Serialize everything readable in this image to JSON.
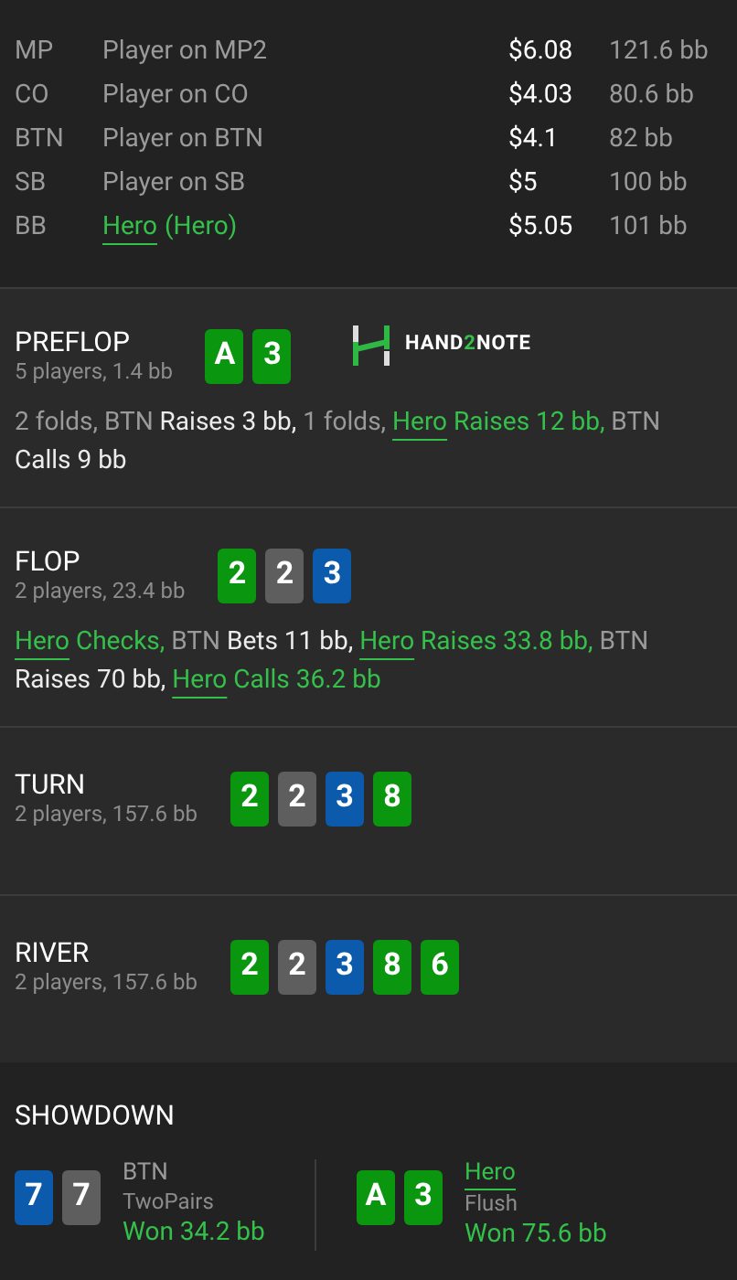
{
  "players": [
    {
      "position": "MP",
      "name": "Player on MP2",
      "is_hero": false,
      "stack": "$6.08",
      "stack_bb": "121.6 bb"
    },
    {
      "position": "CO",
      "name": "Player on CO",
      "is_hero": false,
      "stack": "$4.03",
      "stack_bb": "80.6 bb"
    },
    {
      "position": "BTN",
      "name": "Player on BTN",
      "is_hero": false,
      "stack": "$4.1",
      "stack_bb": "82 bb"
    },
    {
      "position": "SB",
      "name": "Player on SB",
      "is_hero": false,
      "stack": "$5",
      "stack_bb": "100 bb"
    },
    {
      "position": "BB",
      "name": "Hero",
      "is_hero": true,
      "suffix": "(Hero)",
      "stack": "$5.05",
      "stack_bb": "101 bb"
    }
  ],
  "streets": [
    {
      "title": "PREFLOP",
      "info": "5 players, 1.4 bb",
      "cards": [
        {
          "rank": "A",
          "color": "#0a960f"
        },
        {
          "rank": "3",
          "color": "#0a960f"
        }
      ],
      "logo": [
        {
          "text": "HAND",
          "accent": false
        },
        {
          "text": "2",
          "accent": true
        },
        {
          "text": "NOTE",
          "accent": false
        }
      ],
      "actions": [
        {
          "text": "2 folds, BTN ",
          "kind": "plain"
        },
        {
          "text": "Raises 3 bb,",
          "kind": "action"
        },
        {
          "text": " 1 folds, ",
          "kind": "plain"
        },
        {
          "text": "Hero",
          "kind": "hero-link"
        },
        {
          "text": " Raises 12 bb,",
          "kind": "hero"
        },
        {
          "text": " BTN ",
          "kind": "plain"
        },
        {
          "text": "Calls 9 bb",
          "kind": "action"
        }
      ]
    },
    {
      "title": "FLOP",
      "info": "2 players, 23.4 bb",
      "cards": [
        {
          "rank": "2",
          "color": "#0a960f"
        },
        {
          "rank": "2",
          "color": "#5e5e5e"
        },
        {
          "rank": "3",
          "color": "#0b5aab"
        }
      ],
      "actions": [
        {
          "text": "Hero",
          "kind": "hero-link"
        },
        {
          "text": " Checks,",
          "kind": "hero"
        },
        {
          "text": " BTN ",
          "kind": "plain"
        },
        {
          "text": "Bets 11 bb, ",
          "kind": "action"
        },
        {
          "text": "Hero",
          "kind": "hero-link"
        },
        {
          "text": " Raises 33.8 bb,",
          "kind": "hero"
        },
        {
          "text": " BTN ",
          "kind": "plain"
        },
        {
          "text": "Raises 70 bb, ",
          "kind": "action"
        },
        {
          "text": "Hero",
          "kind": "hero-link"
        },
        {
          "text": " Calls 36.2 bb",
          "kind": "hero"
        }
      ]
    },
    {
      "title": "TURN",
      "info": "2 players, 157.6 bb",
      "cards": [
        {
          "rank": "2",
          "color": "#0a960f"
        },
        {
          "rank": "2",
          "color": "#5e5e5e"
        },
        {
          "rank": "3",
          "color": "#0b5aab"
        },
        {
          "rank": "8",
          "color": "#0a960f"
        }
      ]
    },
    {
      "title": "RIVER",
      "info": "2 players, 157.6 bb",
      "cards": [
        {
          "rank": "2",
          "color": "#0a960f"
        },
        {
          "rank": "2",
          "color": "#5e5e5e"
        },
        {
          "rank": "3",
          "color": "#0b5aab"
        },
        {
          "rank": "8",
          "color": "#0a960f"
        },
        {
          "rank": "6",
          "color": "#0a960f"
        }
      ]
    }
  ],
  "showdown": {
    "title": "SHOWDOWN",
    "hands": [
      {
        "name": "BTN",
        "is_hero": false,
        "cards": [
          {
            "rank": "7",
            "color": "#0b5aab"
          },
          {
            "rank": "7",
            "color": "#5e5e5e"
          }
        ],
        "hand": "TwoPairs",
        "result": "Won 34.2 bb"
      },
      {
        "name": "Hero",
        "is_hero": true,
        "cards": [
          {
            "rank": "A",
            "color": "#0a960f"
          },
          {
            "rank": "3",
            "color": "#0a960f"
          }
        ],
        "hand": "Flush",
        "result": "Won 75.6 bb"
      }
    ]
  }
}
